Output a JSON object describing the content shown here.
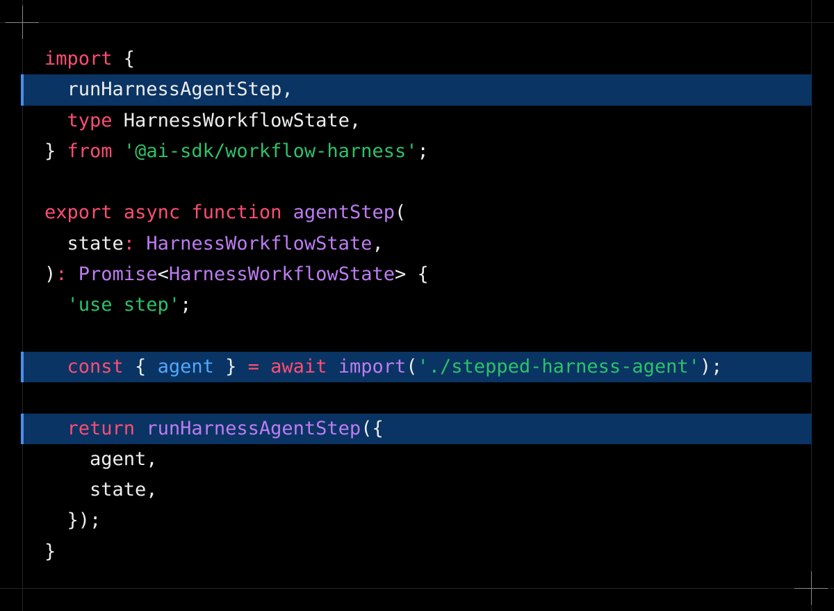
{
  "colors": {
    "background": "#000000",
    "guide_line": "#262626",
    "highlight_background": "#0a3463",
    "highlight_marker": "#4a8ff0",
    "plain": "#ededed",
    "keyword": "#ff4d74",
    "string": "#2cc26a",
    "function": "#bd7cf2",
    "type": "#bd7cf2",
    "variable": "#52a8ff"
  },
  "code": {
    "language": "typescript",
    "lines": [
      {
        "highlighted": false,
        "tokens": [
          {
            "t": "import",
            "c": "keyword"
          },
          {
            "t": " {",
            "c": "plain"
          }
        ]
      },
      {
        "highlighted": true,
        "tokens": [
          {
            "t": "  runHarnessAgentStep,",
            "c": "plain"
          }
        ]
      },
      {
        "highlighted": false,
        "tokens": [
          {
            "t": "  ",
            "c": "plain"
          },
          {
            "t": "type",
            "c": "keyword"
          },
          {
            "t": " HarnessWorkflowState,",
            "c": "plain"
          }
        ]
      },
      {
        "highlighted": false,
        "tokens": [
          {
            "t": "} ",
            "c": "plain"
          },
          {
            "t": "from",
            "c": "keyword"
          },
          {
            "t": " ",
            "c": "plain"
          },
          {
            "t": "'@ai-sdk/workflow-harness'",
            "c": "string"
          },
          {
            "t": ";",
            "c": "plain"
          }
        ]
      },
      {
        "highlighted": false,
        "tokens": []
      },
      {
        "highlighted": false,
        "tokens": [
          {
            "t": "export",
            "c": "keyword"
          },
          {
            "t": " ",
            "c": "plain"
          },
          {
            "t": "async",
            "c": "keyword"
          },
          {
            "t": " ",
            "c": "plain"
          },
          {
            "t": "function",
            "c": "keyword"
          },
          {
            "t": " ",
            "c": "plain"
          },
          {
            "t": "agentStep",
            "c": "function"
          },
          {
            "t": "(",
            "c": "plain"
          }
        ]
      },
      {
        "highlighted": false,
        "tokens": [
          {
            "t": "  state",
            "c": "plain"
          },
          {
            "t": ":",
            "c": "keyword"
          },
          {
            "t": " ",
            "c": "plain"
          },
          {
            "t": "HarnessWorkflowState",
            "c": "type"
          },
          {
            "t": ",",
            "c": "plain"
          }
        ]
      },
      {
        "highlighted": false,
        "tokens": [
          {
            "t": ")",
            "c": "plain"
          },
          {
            "t": ":",
            "c": "keyword"
          },
          {
            "t": " ",
            "c": "plain"
          },
          {
            "t": "Promise",
            "c": "type"
          },
          {
            "t": "<",
            "c": "plain"
          },
          {
            "t": "HarnessWorkflowState",
            "c": "type"
          },
          {
            "t": "> {",
            "c": "plain"
          }
        ]
      },
      {
        "highlighted": false,
        "tokens": [
          {
            "t": "  ",
            "c": "plain"
          },
          {
            "t": "'use step'",
            "c": "string"
          },
          {
            "t": ";",
            "c": "plain"
          }
        ]
      },
      {
        "highlighted": false,
        "tokens": []
      },
      {
        "highlighted": true,
        "tokens": [
          {
            "t": "  ",
            "c": "plain"
          },
          {
            "t": "const",
            "c": "keyword"
          },
          {
            "t": " { ",
            "c": "plain"
          },
          {
            "t": "agent",
            "c": "variable"
          },
          {
            "t": " } ",
            "c": "plain"
          },
          {
            "t": "=",
            "c": "keyword"
          },
          {
            "t": " ",
            "c": "plain"
          },
          {
            "t": "await",
            "c": "keyword"
          },
          {
            "t": " ",
            "c": "plain"
          },
          {
            "t": "import",
            "c": "function"
          },
          {
            "t": "(",
            "c": "plain"
          },
          {
            "t": "'./stepped-harness-agent'",
            "c": "string"
          },
          {
            "t": ");",
            "c": "plain"
          }
        ]
      },
      {
        "highlighted": false,
        "tokens": []
      },
      {
        "highlighted": true,
        "tokens": [
          {
            "t": "  ",
            "c": "plain"
          },
          {
            "t": "return",
            "c": "keyword"
          },
          {
            "t": " ",
            "c": "plain"
          },
          {
            "t": "runHarnessAgentStep",
            "c": "function"
          },
          {
            "t": "({",
            "c": "plain"
          }
        ]
      },
      {
        "highlighted": false,
        "tokens": [
          {
            "t": "    agent,",
            "c": "plain"
          }
        ]
      },
      {
        "highlighted": false,
        "tokens": [
          {
            "t": "    state,",
            "c": "plain"
          }
        ]
      },
      {
        "highlighted": false,
        "tokens": [
          {
            "t": "  });",
            "c": "plain"
          }
        ]
      },
      {
        "highlighted": false,
        "tokens": [
          {
            "t": "}",
            "c": "plain"
          }
        ]
      }
    ]
  }
}
